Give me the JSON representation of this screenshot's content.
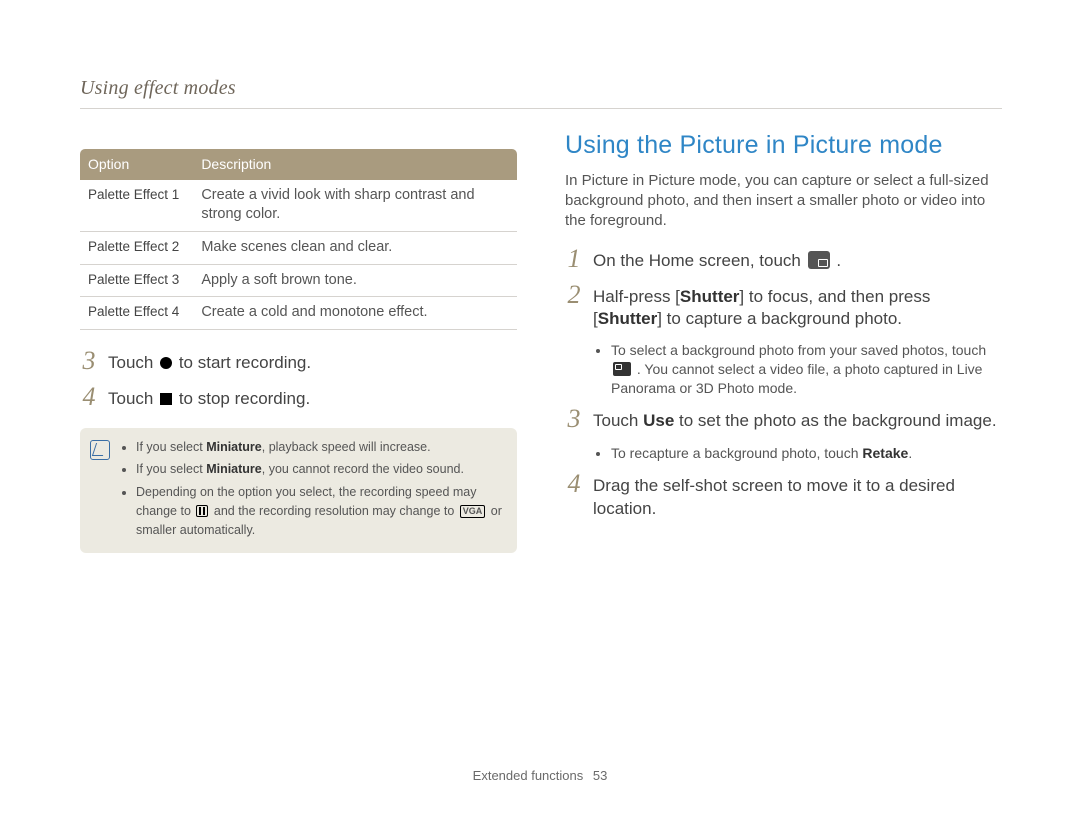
{
  "running_head": "Using effect modes",
  "table": {
    "headers": [
      "Option",
      "Description"
    ],
    "rows": [
      {
        "opt": "Palette Effect 1",
        "desc": "Create a vivid look with sharp contrast and strong color."
      },
      {
        "opt": "Palette Effect 2",
        "desc": "Make scenes clean and clear."
      },
      {
        "opt": "Palette Effect 3",
        "desc": "Apply a soft brown tone."
      },
      {
        "opt": "Palette Effect 4",
        "desc": "Create a cold and monotone effect."
      }
    ]
  },
  "left_steps": {
    "s3_pre": "Touch ",
    "s3_post": " to start recording.",
    "s4_pre": "Touch ",
    "s4_post": " to stop recording."
  },
  "note": {
    "b1_pre": "If you select ",
    "b1_bold": "Miniature",
    "b1_post": ", playback speed will increase.",
    "b2_pre": "If you select ",
    "b2_bold": "Miniature",
    "b2_post": ", you cannot record the video sound.",
    "b3_pre": "Depending on the option you select, the recording speed may change to ",
    "b3_mid": " and the recording resolution may change to ",
    "b3_vga": "VGA",
    "b3_post": " or smaller automatically."
  },
  "right": {
    "heading": "Using the Picture in Picture mode",
    "intro": "In Picture in Picture mode, you can capture or select a full-sized background photo, and then insert a smaller photo or video into the foreground.",
    "s1_pre": "On the Home screen, touch ",
    "s1_post": " .",
    "s2_a": "Half-press [",
    "s2_b": "Shutter",
    "s2_c": "] to focus, and then press [",
    "s2_d": "Shutter",
    "s2_e": "] to capture a background photo.",
    "s2_sub_pre": "To select a background photo from your saved photos, touch ",
    "s2_sub_post": " . You cannot select a video file, a photo captured in Live Panorama or 3D Photo mode.",
    "s3_a": "Touch ",
    "s3_b": "Use",
    "s3_c": " to set the photo as the background image.",
    "s3_sub_a": "To recapture a background photo, touch ",
    "s3_sub_b": "Retake",
    "s3_sub_c": ".",
    "s4": "Drag the self-shot screen to move it to a desired location."
  },
  "footer": {
    "section": "Extended functions",
    "page": "53"
  }
}
